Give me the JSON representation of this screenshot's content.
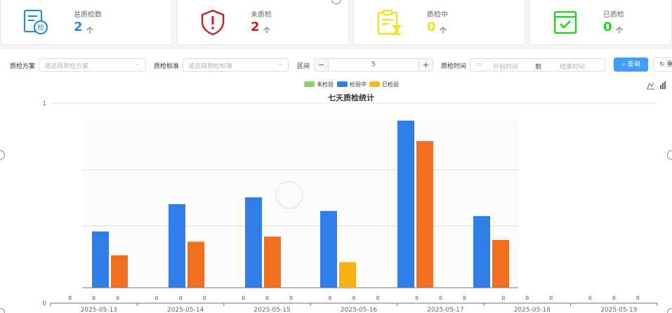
{
  "stats": [
    {
      "label": "总质检数",
      "value": "2",
      "unit": "个",
      "color": "#2a8dd4",
      "icon": "document-check-icon"
    },
    {
      "label": "未质检",
      "value": "2",
      "unit": "个",
      "color": "#c81e1e",
      "icon": "shield-alert-icon"
    },
    {
      "label": "质检中",
      "value": "0",
      "unit": "个",
      "color": "#f2e21c",
      "icon": "clipboard-hourglass-icon"
    },
    {
      "label": "已质检",
      "value": "0",
      "unit": "个",
      "color": "#21d421",
      "icon": "calendar-check-icon"
    }
  ],
  "filters": {
    "plan_label": "质检方案",
    "plan_placeholder": "请选择质检方案",
    "standard_label": "质检标准",
    "standard_placeholder": "请选择质检标准",
    "range_label": "区间",
    "range_value": "5",
    "time_label": "质检时间",
    "start_placeholder": "开始时间",
    "to_label": "到",
    "end_placeholder": "结束时间",
    "query_label": "查询",
    "reset_label": "重"
  },
  "chart_data": {
    "type": "bar",
    "title": "七天质检统计",
    "legend": [
      {
        "name": "未检验",
        "color": "#8fd06b"
      },
      {
        "name": "检验中",
        "color": "#2f7ee8"
      },
      {
        "name": "已检验",
        "color": "#f7b631"
      }
    ],
    "legend_position": "top-center",
    "categories": [
      "2025-05-13",
      "2025-05-14",
      "2025-05-15",
      "2025-05-16",
      "2025-05-17",
      "2025-05-18",
      "2025-05-19"
    ],
    "series": [
      {
        "name": "未检验",
        "values": [
          0,
          0,
          0,
          0,
          0,
          0,
          0
        ]
      },
      {
        "name": "检验中",
        "values": [
          0,
          0,
          0,
          0,
          0,
          0,
          0
        ]
      },
      {
        "name": "已检验",
        "values": [
          0,
          0,
          0,
          0,
          0,
          0,
          0
        ]
      }
    ],
    "ylim": [
      0,
      1
    ],
    "y_ticks": [
      "0",
      "1"
    ],
    "grid": true
  },
  "background_chart": {
    "colors": {
      "blue": "#2f7ee8",
      "orange": "#f26e21",
      "yellow": "#f7b012"
    },
    "groups": [
      [
        {
          "c": "blue",
          "v": 0.33
        },
        {
          "c": "orange",
          "v": 0.19
        }
      ],
      [
        {
          "c": "blue",
          "v": 0.49
        },
        {
          "c": "orange",
          "v": 0.27
        }
      ],
      [
        {
          "c": "blue",
          "v": 0.53
        },
        {
          "c": "orange",
          "v": 0.3
        }
      ],
      [
        {
          "c": "blue",
          "v": 0.45
        },
        {
          "c": "yellow",
          "v": 0.15
        }
      ],
      [
        {
          "c": "blue",
          "v": 0.98
        },
        {
          "c": "orange",
          "v": 0.86
        }
      ],
      [
        {
          "c": "blue",
          "v": 0.42
        },
        {
          "c": "orange",
          "v": 0.28
        }
      ]
    ]
  }
}
